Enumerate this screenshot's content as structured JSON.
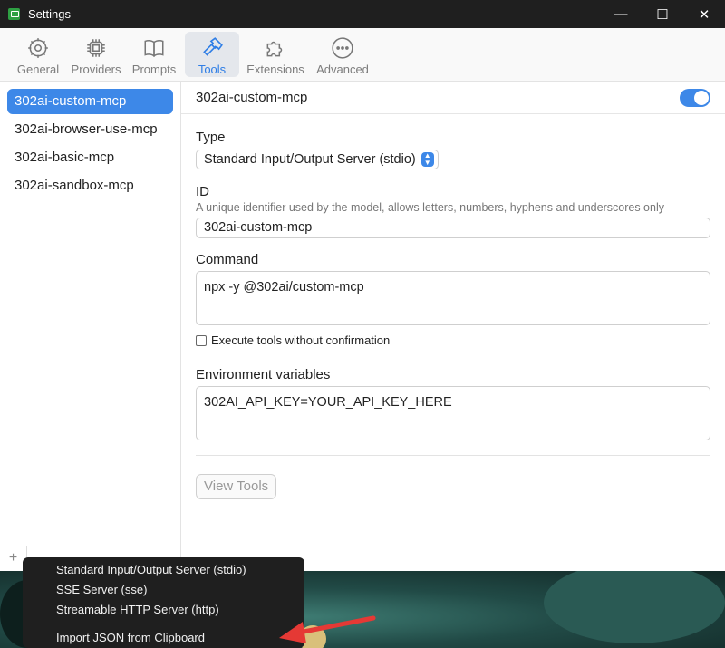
{
  "window": {
    "title": "Settings"
  },
  "window_controls": {
    "minimize": "—",
    "maximize": "☐",
    "close": "✕"
  },
  "tabs": [
    {
      "label": "General",
      "icon": "gear-icon"
    },
    {
      "label": "Providers",
      "icon": "chip-icon"
    },
    {
      "label": "Prompts",
      "icon": "book-icon"
    },
    {
      "label": "Tools",
      "icon": "hammer-icon",
      "active": true
    },
    {
      "label": "Extensions",
      "icon": "puzzle-icon"
    },
    {
      "label": "Advanced",
      "icon": "ellipsis-icon"
    }
  ],
  "sidebar": {
    "items": [
      {
        "label": "302ai-custom-mcp",
        "active": true
      },
      {
        "label": "302ai-browser-use-mcp"
      },
      {
        "label": "302ai-basic-mcp"
      },
      {
        "label": "302ai-sandbox-mcp"
      }
    ],
    "add_label": "+"
  },
  "server": {
    "name": "302ai-custom-mcp",
    "enabled": true,
    "type_label": "Type",
    "type_value": "Standard Input/Output Server (stdio)",
    "id_label": "ID",
    "id_help": "A unique identifier used by the model, allows letters, numbers, hyphens and underscores only",
    "id_value": "302ai-custom-mcp",
    "command_label": "Command",
    "command_value": "npx -y @302ai/custom-mcp",
    "confirm_label": "Execute tools without confirmation",
    "env_label": "Environment variables",
    "env_value": "302AI_API_KEY=YOUR_API_KEY_HERE",
    "view_tools_label": "View Tools"
  },
  "menu": {
    "items": [
      "Standard Input/Output Server (stdio)",
      "SSE Server (sse)",
      "Streamable HTTP Server (http)"
    ],
    "import_label": "Import JSON from Clipboard"
  },
  "colors": {
    "accent": "#3d88e8",
    "arrow": "#e53935",
    "titlebar": "#1f1f1f"
  }
}
